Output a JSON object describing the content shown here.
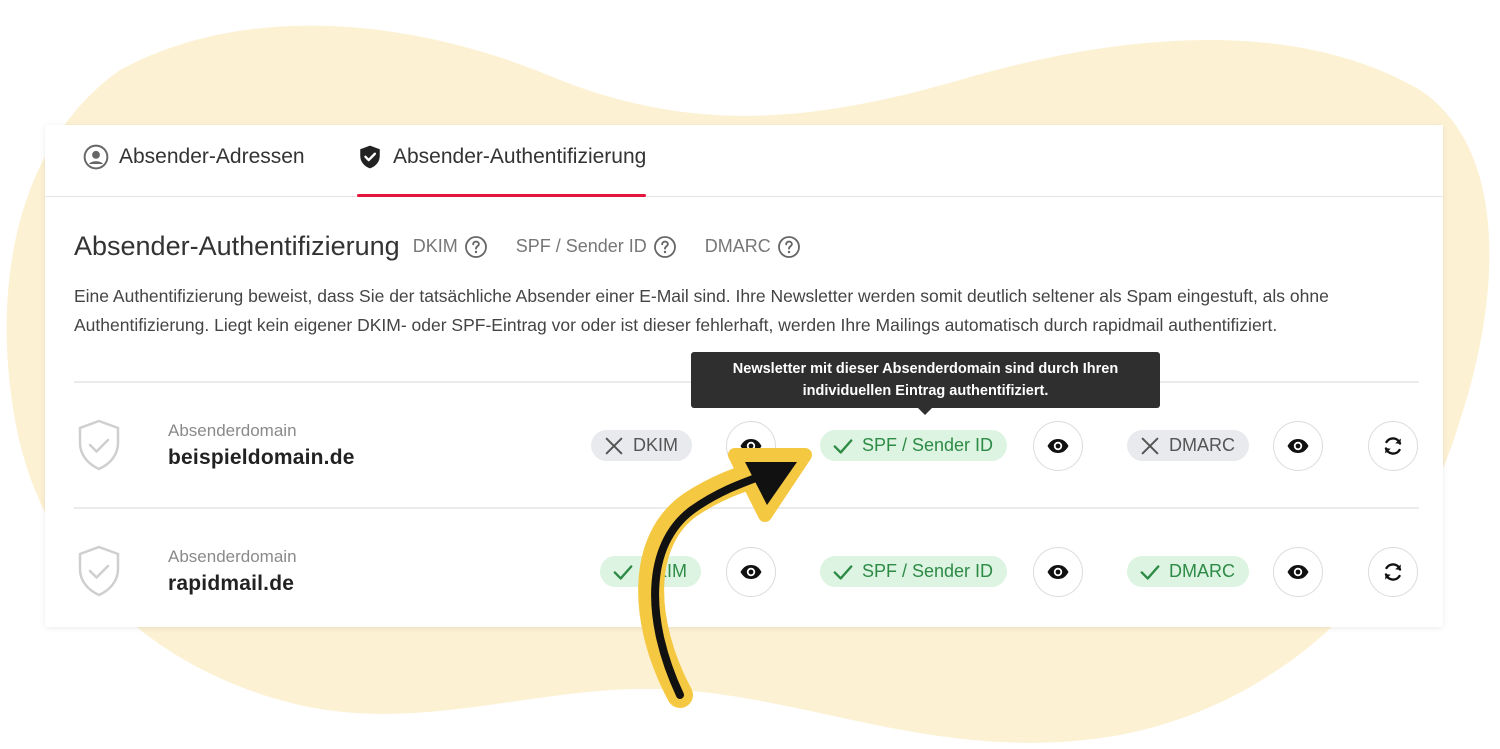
{
  "tabs": [
    {
      "label": "Absender-Adressen",
      "icon": "user-circle-icon",
      "active": false
    },
    {
      "label": "Absender-Authentifizierung",
      "icon": "shield-check-icon",
      "active": true
    }
  ],
  "header": {
    "title": "Absender-Authentifizierung",
    "help_links": [
      "DKIM",
      "SPF / Sender ID",
      "DMARC"
    ]
  },
  "description": "Eine Authentifizierung beweist, dass Sie der tatsächliche Absender einer E-Mail sind. Ihre Newsletter werden somit deutlich seltener als Spam eingestuft, als ohne Authentifizierung. Liegt kein eigener DKIM- oder SPF-Eintrag vor oder ist dieser fehlerhaft, werden Ihre Mailings automatisch durch rapidmail authentifiziert.",
  "tooltip": {
    "line1": "Newsletter mit dieser Absenderdomain sind durch Ihren",
    "line2": "individuellen Eintrag authentifiziert."
  },
  "domains": [
    {
      "label": "Absenderdomain",
      "value": "beispieldomain.de",
      "dkim": {
        "label": "DKIM",
        "status": "fail"
      },
      "spf": {
        "label": "SPF / Sender ID",
        "status": "ok"
      },
      "dmarc": {
        "label": "DMARC",
        "status": "fail"
      }
    },
    {
      "label": "Absenderdomain",
      "value": "rapidmail.de",
      "dkim": {
        "label": "DKIM",
        "status": "ok"
      },
      "spf": {
        "label": "SPF / Sender ID",
        "status": "ok"
      },
      "dmarc": {
        "label": "DMARC",
        "status": "ok"
      }
    }
  ],
  "colors": {
    "accent": "#e3153d",
    "ok_bg": "#dcf4e1",
    "ok_text": "#2e8b46",
    "fail_bg": "#e8eaee",
    "blob": "#fdf1d3",
    "arrow": "#f5c842"
  }
}
